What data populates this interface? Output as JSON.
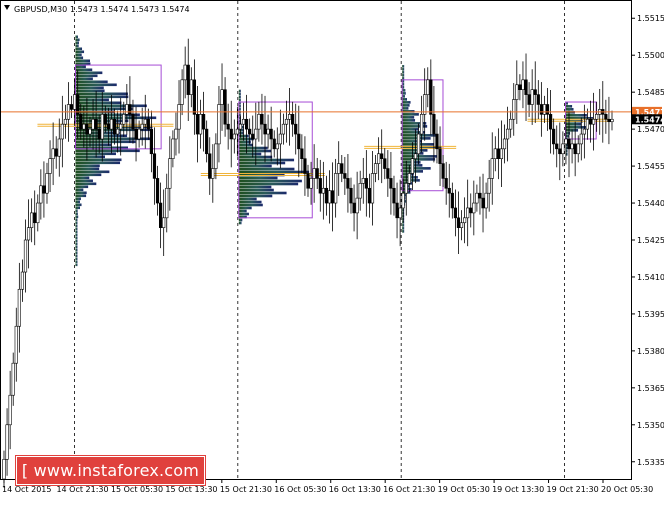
{
  "chart_data": {
    "type": "candlestick",
    "symbol_label": "GBPUSD,M30",
    "ohlc_label": "1.5473 1.5474 1.5473 1.5474",
    "ylim": [
      1.5328,
      1.5522
    ],
    "y_ticks": [
      "1.5515",
      "1.5500",
      "1.5485",
      "1.5470",
      "1.5455",
      "1.5440",
      "1.5425",
      "1.5410",
      "1.5395",
      "1.5380",
      "1.5365",
      "1.5350",
      "1.5335"
    ],
    "x_labels": [
      "14 Oct 2015",
      "14 Oct 21:30",
      "15 Oct 05:30",
      "15 Oct 13:30",
      "15 Oct 21:30",
      "16 Oct 05:30",
      "16 Oct 13:30",
      "16 Oct 21:30",
      "19 Oct 05:30",
      "19 Oct 13:30",
      "19 Oct 21:30",
      "20 Oct 05:30"
    ],
    "session_separators": [
      "14 Oct 21:30",
      "15 Oct 21:30",
      "16 Oct 21:30",
      "19 Oct 21:30"
    ],
    "price_tags": [
      {
        "value": "1.5477",
        "price": 1.5477,
        "color": "#e8702a"
      },
      {
        "value": "1.5474",
        "price": 1.5474,
        "color": "#000000"
      }
    ],
    "close_series": [
      1.5336,
      1.535,
      1.5362,
      1.5375,
      1.539,
      1.5405,
      1.5412,
      1.5425,
      1.543,
      1.5436,
      1.5432,
      1.544,
      1.5447,
      1.5444,
      1.5452,
      1.5458,
      1.5462,
      1.5459,
      1.5466,
      1.5472,
      1.5474,
      1.548,
      1.5478,
      1.5484,
      1.5476,
      1.547,
      1.5472,
      1.5468,
      1.547,
      1.5474,
      1.547,
      1.5466,
      1.5476,
      1.5472,
      1.547,
      1.5474,
      1.5468,
      1.547,
      1.5472,
      1.5476,
      1.548,
      1.5476,
      1.547,
      1.5466,
      1.547,
      1.5472,
      1.5474,
      1.547,
      1.546,
      1.545,
      1.544,
      1.543,
      1.5434,
      1.5446,
      1.5458,
      1.5466,
      1.547,
      1.548,
      1.549,
      1.5496,
      1.5484,
      1.549,
      1.5476,
      1.5468,
      1.5476,
      1.547,
      1.546,
      1.545,
      1.5454,
      1.5464,
      1.548,
      1.5486,
      1.5472,
      1.547,
      1.5466,
      1.5468,
      1.547,
      1.5472,
      1.5474,
      1.547,
      1.5468,
      1.5466,
      1.547,
      1.5476,
      1.5472,
      1.5468,
      1.547,
      1.5466,
      1.5462,
      1.5464,
      1.5468,
      1.5472,
      1.5474,
      1.5476,
      1.5472,
      1.5468,
      1.5462,
      1.5458,
      1.5452,
      1.5446,
      1.545,
      1.5454,
      1.545,
      1.5444,
      1.5446,
      1.544,
      1.5445,
      1.544,
      1.5452,
      1.5456,
      1.5452,
      1.545,
      1.5446,
      1.544,
      1.5436,
      1.5442,
      1.5448,
      1.545,
      1.5446,
      1.544,
      1.5452,
      1.5456,
      1.546,
      1.5458,
      1.5454,
      1.545,
      1.5446,
      1.544,
      1.5434,
      1.5438,
      1.5444,
      1.5448,
      1.5452,
      1.5458,
      1.546,
      1.5468,
      1.5476,
      1.5484,
      1.549,
      1.5476,
      1.5468,
      1.5462,
      1.5456,
      1.545,
      1.5446,
      1.5444,
      1.5438,
      1.5434,
      1.543,
      1.5432,
      1.5434,
      1.5438,
      1.5436,
      1.544,
      1.5444,
      1.5442,
      1.5438,
      1.5444,
      1.545,
      1.5458,
      1.5462,
      1.5458,
      1.5462,
      1.5466,
      1.547,
      1.5474,
      1.5482,
      1.5488,
      1.5486,
      1.549,
      1.5484,
      1.548,
      1.5486,
      1.5484,
      1.548,
      1.5476,
      1.548,
      1.5476,
      1.547,
      1.5464,
      1.5462,
      1.546,
      1.5464,
      1.5466,
      1.5462,
      1.5464,
      1.546,
      1.5464,
      1.5468,
      1.547,
      1.5474,
      1.5472,
      1.5474,
      1.5476,
      1.5478,
      1.5476,
      1.5474,
      1.5473,
      1.5474
    ],
    "profiles": [
      {
        "session": "14 Oct 21:30",
        "price_high": 1.5508,
        "price_low": 1.5414,
        "box_high": 1.5496,
        "box_low": 1.5462,
        "poc": 1.5472,
        "peak_width": 1.0
      },
      {
        "session": "15 Oct 21:30",
        "price_high": 1.5486,
        "price_low": 1.5431,
        "box_high": 1.5481,
        "box_low": 1.5434,
        "poc": 1.5452,
        "peak_width": 0.8
      },
      {
        "session": "16 Oct 21:30",
        "price_high": 1.5496,
        "price_low": 1.5427,
        "box_high": 1.549,
        "box_low": 1.5445,
        "poc": 1.5463,
        "peak_width": 0.45
      },
      {
        "session": "19 Oct 21:30",
        "price_high": 1.5481,
        "price_low": 1.5459,
        "box_high": 1.5481,
        "box_low": 1.5466,
        "poc": 1.5474,
        "peak_width": 0.55
      }
    ],
    "colors": {
      "profile": "#1f5a1f",
      "box": "#a64cd6",
      "poc": "#f0b43a",
      "grid": "#c8c8c8"
    }
  },
  "watermark": "[ www.instaforex.com ]"
}
